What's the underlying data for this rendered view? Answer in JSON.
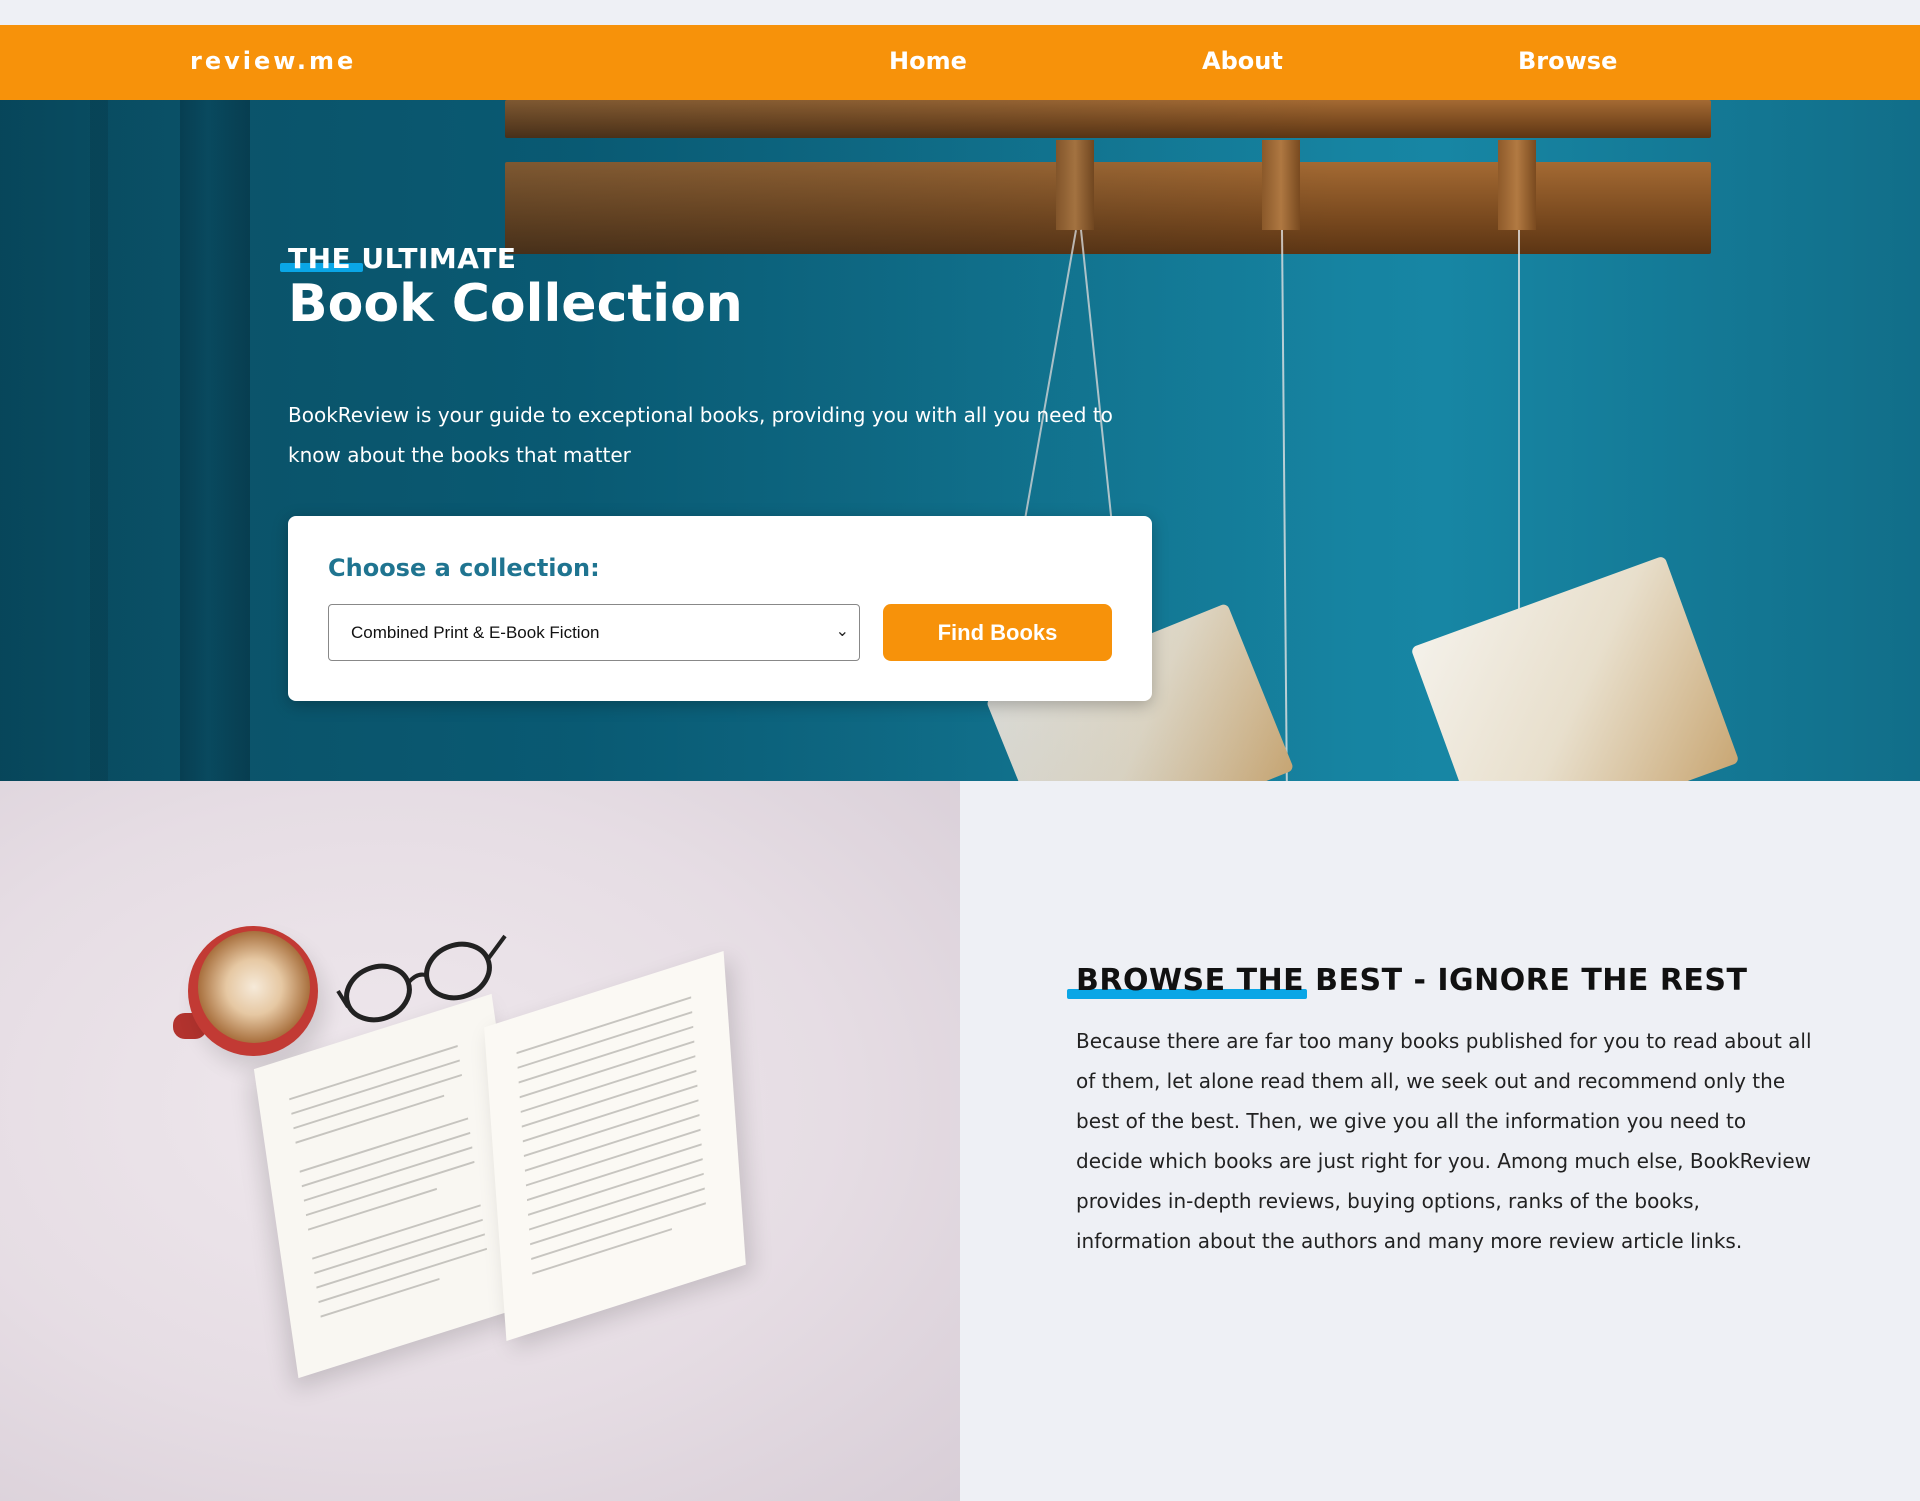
{
  "nav": {
    "brand": "review.me",
    "links": [
      "Home",
      "About",
      "Browse"
    ],
    "accent_color": "#f7920a"
  },
  "hero": {
    "kicker": "THE ULTIMATE",
    "title": "Book Collection",
    "description": "BookReview is your guide to exceptional books, providing you with all you need to know about the books that matter",
    "card": {
      "label": "Choose a collection:",
      "selected_option": "Combined Print & E-Book Fiction",
      "button_label": "Find Books"
    }
  },
  "section": {
    "title": "BROWSE THE BEST - IGNORE THE REST",
    "text": "Because there are far too many books published for you to read about all of them, let alone read them all, we seek out and recommend only the best of the best. Then, we give you all the information you need to decide which books are just right for you. Among much else, BookReview provides in-depth reviews, buying options, ranks of the books, information about the authors and many more review article links.",
    "underline_color": "#0aa6e6"
  },
  "icons": [
    "chevron-down-icon"
  ]
}
